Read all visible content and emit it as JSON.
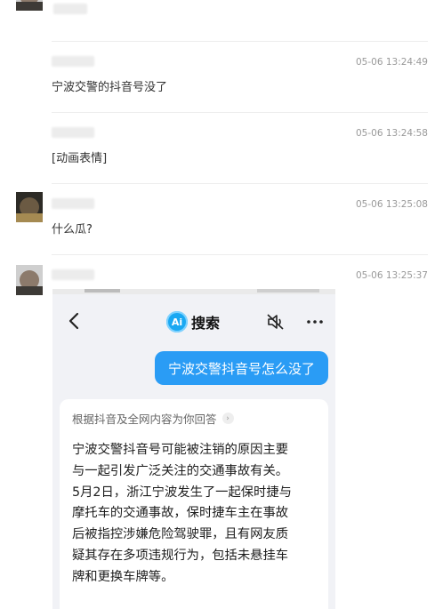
{
  "conversation": {
    "messages": [
      {
        "time": "05-06 13:24:49",
        "text": "宁波交警的抖音号没了"
      },
      {
        "time": "05-06 13:24:58",
        "text": "[动画表情]"
      },
      {
        "time": "05-06 13:25:08",
        "text": "什么瓜?"
      },
      {
        "time": "05-06 13:25:37",
        "text": ""
      }
    ]
  },
  "embedded_screenshot": {
    "header": {
      "logo_text": "Ai",
      "title": "搜索"
    },
    "query": "宁波交警抖音号怎么没了",
    "answer": {
      "source_label": "根据抖音及全网内容为你回答",
      "lines": [
        "宁波交警抖音号可能被注销的原因主要",
        "与一起引发广泛关注的交通事故有关。",
        "5月2日，浙江宁波发生了一起保时捷与",
        "摩托车的交通事故，保时捷车主在事故",
        "后被指控涉嫌危险驾驶罪，且有网友质",
        "疑其存在多项违规行为，包括未悬挂车",
        "牌和更换车牌等。"
      ]
    }
  },
  "icons": {
    "back": "chevron-left-icon",
    "mute": "speaker-muted-icon",
    "more": "more-horizontal-icon",
    "source_arrow": "chevron-right-icon"
  },
  "colors": {
    "accent": "#2a9cf5",
    "timestamp": "#999999",
    "divider": "#ededed"
  }
}
